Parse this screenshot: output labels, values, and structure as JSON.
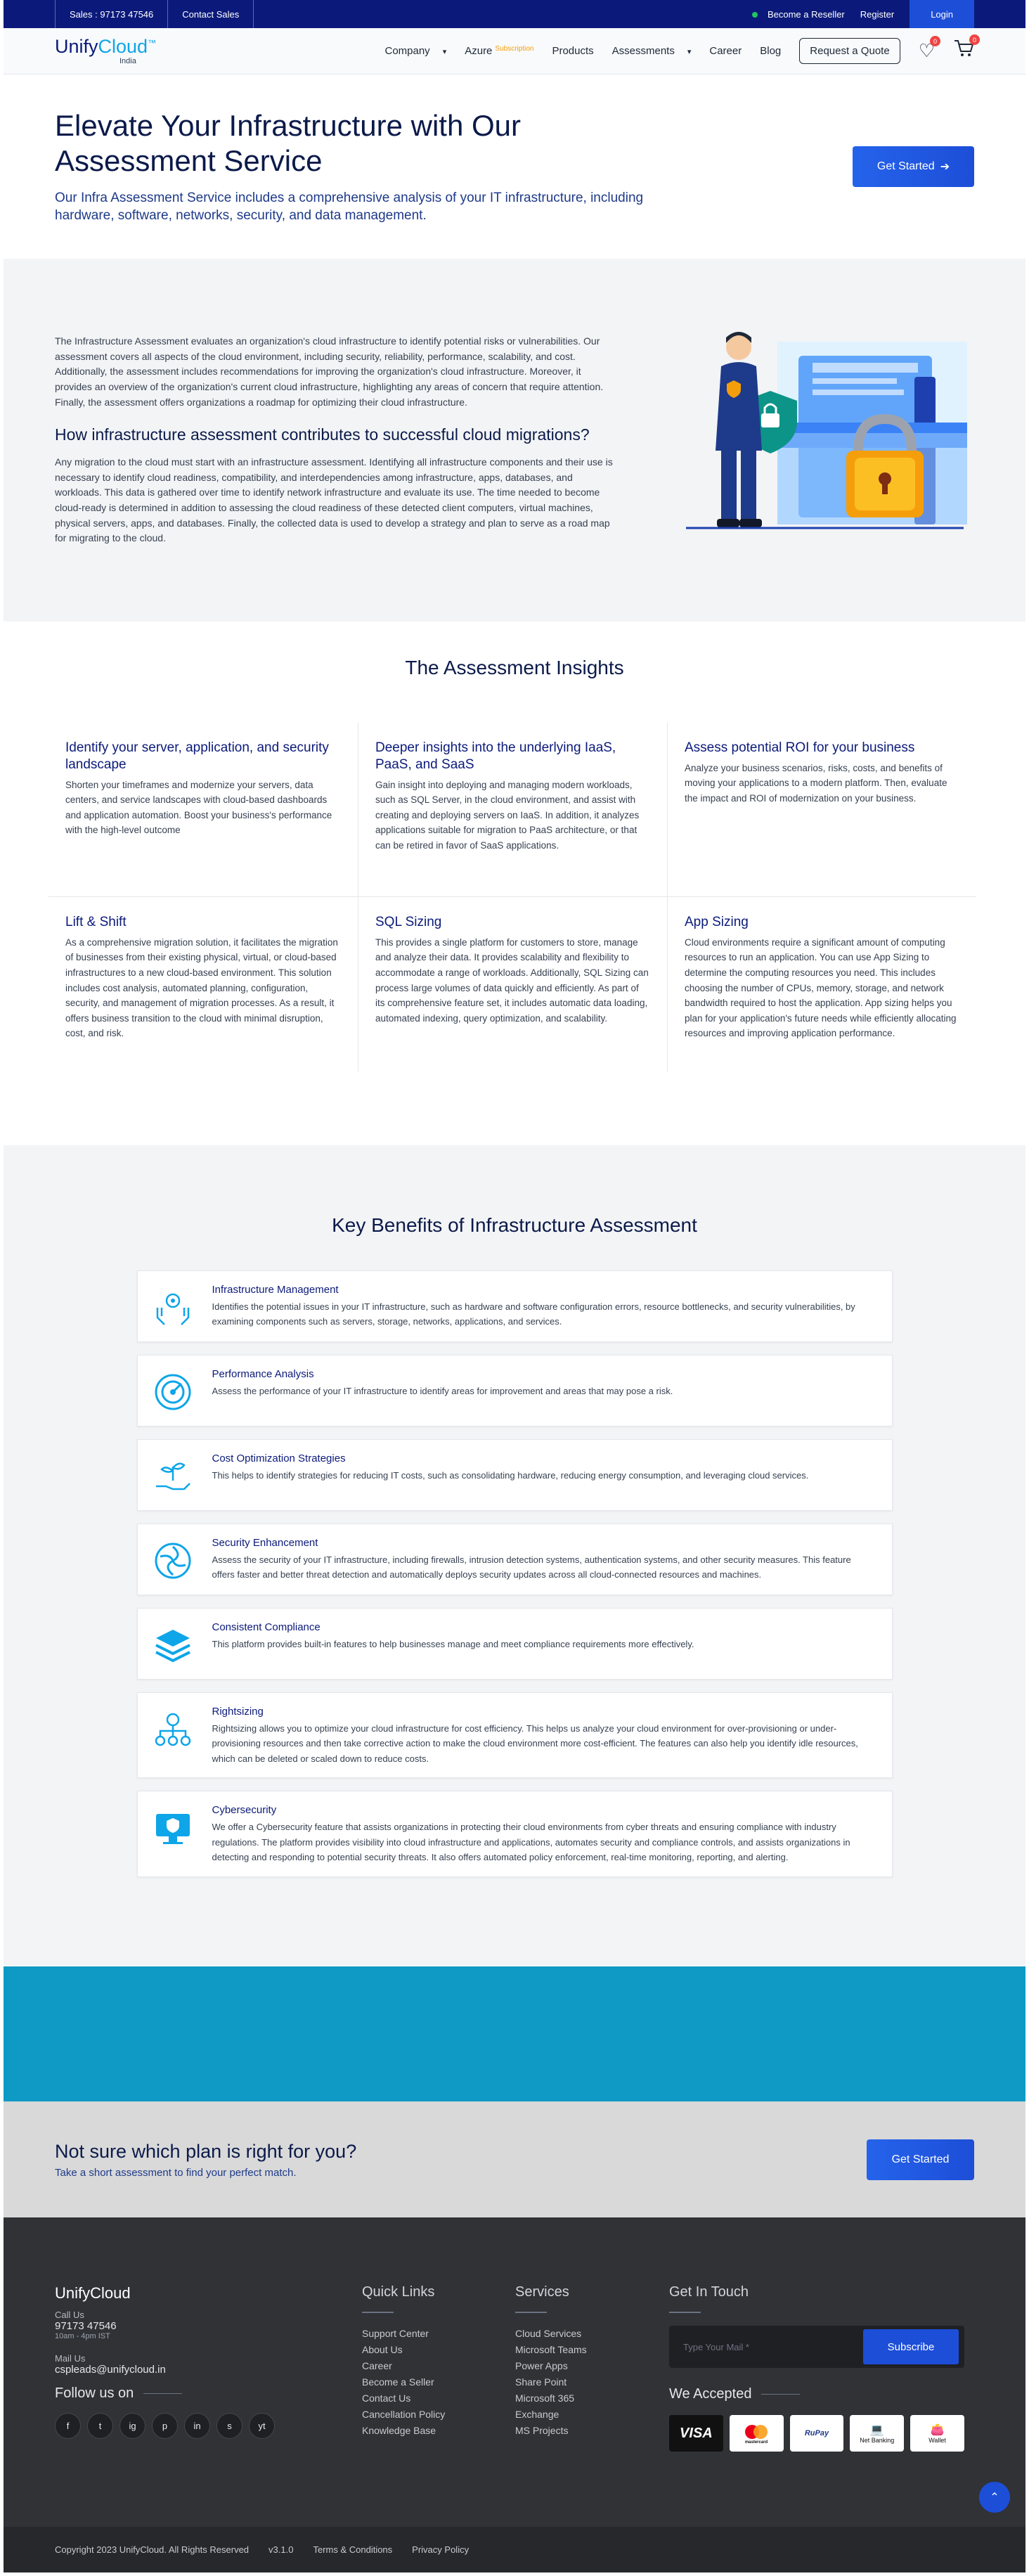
{
  "topbar": {
    "sales": "Sales : 97173 47546",
    "contact": "Contact Sales",
    "reseller": "Become a Reseller",
    "register": "Register",
    "login": "Login"
  },
  "nav": {
    "brand_main": "Unify",
    "brand_accent": "Cloud",
    "brand_sup": "™",
    "brand_sub": "India",
    "items": [
      "Company",
      "Azure",
      "Products",
      "Assessments",
      "Career",
      "Blog"
    ],
    "azure_sup": "Subscription",
    "quote": "Request a Quote",
    "wishlist_count": "0",
    "cart_count": "0"
  },
  "hero": {
    "title": "Elevate Your Infrastructure with Our Assessment Service",
    "subtitle": "Our Infra Assessment Service includes a comprehensive analysis of your IT infrastructure, including hardware, software, networks, security, and data management.",
    "cta": "Get Started"
  },
  "overview": {
    "para1": "The Infrastructure Assessment evaluates an organization's cloud infrastructure to identify potential risks or vulnerabilities. Our assessment covers all aspects of the cloud environment, including security, reliability, performance, scalability, and cost. Additionally, the assessment includes recommendations for improving the organization's cloud infrastructure. Moreover, it provides an overview of the organization's current cloud infrastructure, highlighting any areas of concern that require attention. Finally, the assessment offers organizations a roadmap for optimizing their cloud infrastructure.",
    "heading": "How infrastructure assessment contributes to successful cloud migrations?",
    "para2": "Any migration to the cloud must start with an infrastructure assessment. Identifying all infrastructure components and their use is necessary to identify cloud readiness, compatibility, and interdependencies among infrastructure, apps, databases, and workloads. This data is gathered over time to identify network infrastructure and evaluate its use. The time needed to become cloud-ready is determined in addition to assessing the cloud readiness of these detected client computers, virtual machines, physical servers, apps, and databases. Finally, the collected data is used to develop a strategy and plan to serve as a road map for migrating to the cloud."
  },
  "insights": {
    "title": "The Assessment Insights",
    "items": [
      {
        "title": "Identify your server, application, and security landscape",
        "body": "Shorten your timeframes and modernize your servers, data centers, and service landscapes with cloud-based dashboards and application automation. Boost your business's performance with the high-level outcome"
      },
      {
        "title": "Deeper insights into the underlying IaaS, PaaS, and SaaS",
        "body": "Gain insight into deploying and managing modern workloads, such as SQL Server, in the cloud environment, and assist with creating and deploying servers on IaaS. In addition, it analyzes applications suitable for migration to PaaS architecture, or that can be retired in favor of SaaS applications."
      },
      {
        "title": "Assess potential ROI for your business",
        "body": "Analyze your business scenarios, risks, costs, and benefits of moving your applications to a modern platform. Then, evaluate the impact and ROI of modernization on your business."
      },
      {
        "title": "Lift & Shift",
        "body": "As a comprehensive migration solution, it facilitates the migration of businesses from their existing physical, virtual, or cloud-based infrastructures to a new cloud-based environment. This solution includes cost analysis, automated planning, configuration, security, and management of migration processes. As a result, it offers business transition to the cloud with minimal disruption, cost, and risk."
      },
      {
        "title": "SQL Sizing",
        "body": "This provides a single platform for customers to store, manage and analyze their data. It provides scalability and flexibility to accommodate a range of workloads. Additionally, SQL Sizing can process large volumes of data quickly and efficiently. As part of its comprehensive feature set, it includes automatic data loading, automated indexing, query optimization, and scalability."
      },
      {
        "title": "App Sizing",
        "body": "Cloud environments require a significant amount of computing resources to run an application. You can use App Sizing to determine the computing resources you need. This includes choosing the number of CPUs, memory, storage, and network bandwidth required to host the application. App sizing helps you plan for your application's future needs while efficiently allocating resources and improving application performance."
      }
    ]
  },
  "benefits": {
    "title": "Key Benefits of Infrastructure Assessment",
    "items": [
      {
        "icon": "hands-gear-icon",
        "title": "Infrastructure Management",
        "body": "Identifies the potential issues in your IT infrastructure, such as hardware and software configuration errors, resource bottlenecks, and security vulnerabilities, by examining components such as servers, storage, networks, applications, and services."
      },
      {
        "icon": "gauge-icon",
        "title": "Performance Analysis",
        "body": "Assess the performance of your IT infrastructure to identify areas for improvement and areas that may pose a risk."
      },
      {
        "icon": "plant-hand-icon",
        "title": "Cost Optimization Strategies",
        "body": "This helps to identify strategies for reducing IT costs, such as consolidating hardware, reducing energy consumption, and leveraging cloud services."
      },
      {
        "icon": "security-swirl-icon",
        "title": "Security Enhancement",
        "body": "Assess the security of your IT infrastructure, including firewalls, intrusion detection systems, authentication systems, and other security measures. This feature offers faster and better threat detection and automatically deploys security updates across all cloud-connected resources and machines."
      },
      {
        "icon": "layers-icon",
        "title": "Consistent Compliance",
        "body": "This platform provides built-in features to help businesses manage and meet compliance requirements more effectively."
      },
      {
        "icon": "org-chart-icon",
        "title": "Rightsizing",
        "body": "Rightsizing allows you to optimize your cloud infrastructure for cost efficiency. This helps us analyze your cloud environment for over-provisioning or under-provisioning resources and then take corrective action to make the cloud environment more cost-efficient. The features can also help you identify idle resources, which can be deleted or scaled down to reduce costs."
      },
      {
        "icon": "monitor-shield-icon",
        "title": "Cybersecurity",
        "body": "We offer a Cybersecurity feature that assists organizations in protecting their cloud environments from cyber threats and ensuring compliance with industry regulations. The platform provides visibility into cloud infrastructure and applications, automates security and compliance controls, and assists organizations in detecting and responding to potential security threats. It also offers automated policy enforcement, real-time monitoring, reporting, and alerting."
      }
    ]
  },
  "cta": {
    "title": "Not sure which plan is right for you?",
    "subtitle": "Take a short assessment to find your perfect match.",
    "button": "Get Started"
  },
  "footer": {
    "brand": "UnifyCloud",
    "call_label": "Call Us",
    "phone": "97173 47546",
    "hours": "10am - 4pm IST",
    "mail_label": "Mail Us",
    "email": "cspleads@unifycloud.in",
    "follow": "Follow us on",
    "socials": [
      "f",
      "t",
      "ig",
      "p",
      "in",
      "s",
      "yt"
    ],
    "quick_title": "Quick Links",
    "quick_links": [
      "Support Center",
      "About Us",
      "Career",
      "Become a Seller",
      "Contact Us",
      "Cancellation Policy",
      "Knowledge Base"
    ],
    "services_title": "Services",
    "services": [
      "Cloud Services",
      "Microsoft Teams",
      "Power Apps",
      "Share Point",
      "Microsoft 365",
      "Exchange",
      "MS Projects"
    ],
    "touch_title": "Get In Touch",
    "mail_placeholder": "Type Your Mail *",
    "subscribe": "Subscribe",
    "accepted": "We Accepted",
    "cards": [
      "VISA",
      "mastercard",
      "RuPay",
      "Net Banking",
      "Wallet"
    ],
    "copyright": "Copyright 2023 UnifyCloud. All Rights Reserved",
    "version": "v3.1.0",
    "terms": "Terms & Conditions",
    "privacy": "Privacy Policy"
  }
}
